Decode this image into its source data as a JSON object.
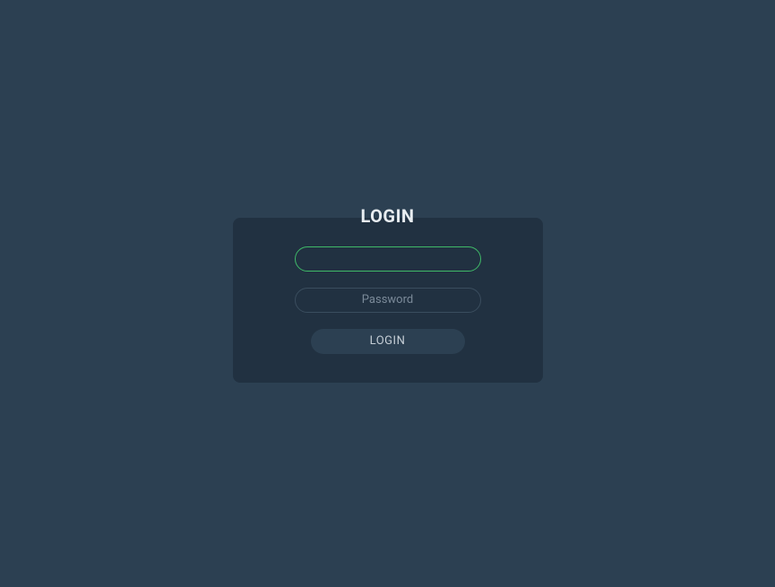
{
  "login": {
    "title": "LOGIN",
    "username_placeholder": "",
    "username_value": "",
    "password_placeholder": "Password",
    "password_value": "",
    "button_label": "LOGIN"
  }
}
